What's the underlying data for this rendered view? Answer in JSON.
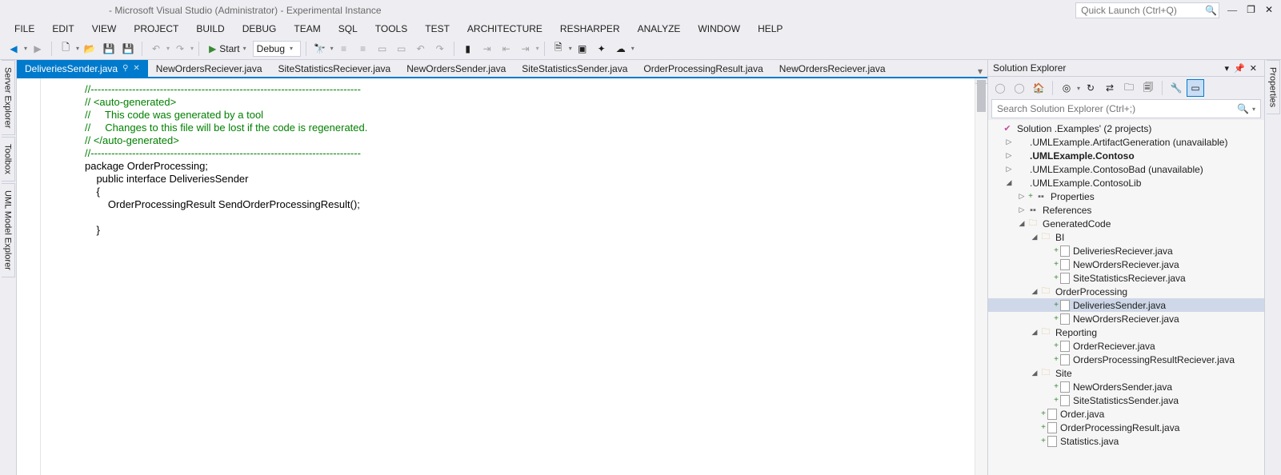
{
  "title": " - Microsoft Visual Studio (Administrator) - Experimental Instance",
  "quick_launch_placeholder": "Quick Launch (Ctrl+Q)",
  "menu": [
    "FILE",
    "EDIT",
    "VIEW",
    "PROJECT",
    "BUILD",
    "DEBUG",
    "TEAM",
    "SQL",
    "TOOLS",
    "TEST",
    "ARCHITECTURE",
    "RESHARPER",
    "ANALYZE",
    "WINDOW",
    "HELP"
  ],
  "toolbar": {
    "start_label": "Start",
    "config_label": "Debug"
  },
  "left_tool_tabs": [
    "Server Explorer",
    "Toolbox",
    "UML Model Explorer"
  ],
  "right_tool_tabs": [
    "Properties"
  ],
  "doc_tabs": [
    {
      "label": "DeliveriesSender.java",
      "active": true,
      "pinned": true
    },
    {
      "label": "NewOrdersReciever.java"
    },
    {
      "label": "SiteStatisticsReciever.java"
    },
    {
      "label": "NewOrdersSender.java"
    },
    {
      "label": "SiteStatisticsSender.java"
    },
    {
      "label": "OrderProcessingResult.java"
    },
    {
      "label": "NewOrdersReciever.java"
    }
  ],
  "editor_lines": [
    {
      "t": "//------------------------------------------------------------------------------",
      "c": "c"
    },
    {
      "t": "// <auto-generated>",
      "c": "c"
    },
    {
      "t": "//     This code was generated by a tool",
      "c": "c"
    },
    {
      "t": "//     Changes to this file will be lost if the code is regenerated.",
      "c": "c"
    },
    {
      "t": "// </auto-generated>",
      "c": "c"
    },
    {
      "t": "//------------------------------------------------------------------------------",
      "c": "c"
    },
    {
      "t": "package OrderProcessing;",
      "c": ""
    },
    {
      "t": "    public interface DeliveriesSender",
      "c": ""
    },
    {
      "t": "    {",
      "c": ""
    },
    {
      "t": "        OrderProcessingResult SendOrderProcessingResult();",
      "c": ""
    },
    {
      "t": "",
      "c": ""
    },
    {
      "t": "    }",
      "c": ""
    }
  ],
  "solution_explorer": {
    "title": "Solution Explorer",
    "search_placeholder": "Search Solution Explorer (Ctrl+;)",
    "tree": [
      {
        "d": 0,
        "tw": "",
        "ic": "sol",
        "label": "Solution        .Examples' (2 projects)",
        "plus": false
      },
      {
        "d": 1,
        "tw": "▷",
        "ic": "proj",
        "label": ".UMLExample.ArtifactGeneration (unavailable)",
        "plus": false
      },
      {
        "d": 1,
        "tw": "▷",
        "ic": "proj",
        "label": ".UMLExample.Contoso",
        "bold": true,
        "plus": false
      },
      {
        "d": 1,
        "tw": "▷",
        "ic": "proj",
        "label": ".UMLExample.ContosoBad (unavailable)",
        "plus": false
      },
      {
        "d": 1,
        "tw": "◢",
        "ic": "proj",
        "label": ".UMLExample.ContosoLib",
        "plus": false
      },
      {
        "d": 2,
        "tw": "▷",
        "ic": "ref",
        "label": "Properties",
        "plus": true
      },
      {
        "d": 2,
        "tw": "▷",
        "ic": "ref",
        "label": "References",
        "plus": false
      },
      {
        "d": 2,
        "tw": "◢",
        "ic": "folder",
        "label": "GeneratedCode",
        "plus": false
      },
      {
        "d": 3,
        "tw": "◢",
        "ic": "folder",
        "label": "BI",
        "plus": false
      },
      {
        "d": 4,
        "tw": "",
        "ic": "file",
        "label": "DeliveriesReciever.java",
        "plus": true
      },
      {
        "d": 4,
        "tw": "",
        "ic": "file",
        "label": "NewOrdersReciever.java",
        "plus": true
      },
      {
        "d": 4,
        "tw": "",
        "ic": "file",
        "label": "SiteStatisticsReciever.java",
        "plus": true
      },
      {
        "d": 3,
        "tw": "◢",
        "ic": "folder",
        "label": "OrderProcessing",
        "plus": false
      },
      {
        "d": 4,
        "tw": "",
        "ic": "file",
        "label": "DeliveriesSender.java",
        "sel": true,
        "plus": true
      },
      {
        "d": 4,
        "tw": "",
        "ic": "file",
        "label": "NewOrdersReciever.java",
        "plus": true
      },
      {
        "d": 3,
        "tw": "◢",
        "ic": "folder",
        "label": "Reporting",
        "plus": false
      },
      {
        "d": 4,
        "tw": "",
        "ic": "file",
        "label": "OrderReciever.java",
        "plus": true
      },
      {
        "d": 4,
        "tw": "",
        "ic": "file",
        "label": "OrdersProcessingResultReciever.java",
        "plus": true
      },
      {
        "d": 3,
        "tw": "◢",
        "ic": "folder",
        "label": "Site",
        "plus": false
      },
      {
        "d": 4,
        "tw": "",
        "ic": "file",
        "label": "NewOrdersSender.java",
        "plus": true
      },
      {
        "d": 4,
        "tw": "",
        "ic": "file",
        "label": "SiteStatisticsSender.java",
        "plus": true
      },
      {
        "d": 3,
        "tw": "",
        "ic": "file",
        "label": "Order.java",
        "plus": true
      },
      {
        "d": 3,
        "tw": "",
        "ic": "file",
        "label": "OrderProcessingResult.java",
        "plus": true
      },
      {
        "d": 3,
        "tw": "",
        "ic": "file",
        "label": "Statistics.java",
        "plus": true
      }
    ]
  }
}
